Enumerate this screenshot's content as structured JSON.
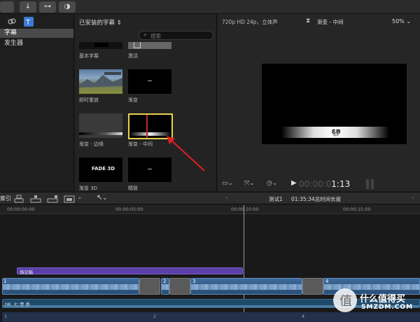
{
  "toolbar": {
    "download_icon": "↓",
    "key_icon": "⊶",
    "half_icon": "◑"
  },
  "sidebar": {
    "items": [
      {
        "label": "字幕",
        "selected": true
      },
      {
        "label": "发生器",
        "selected": false
      }
    ]
  },
  "browser": {
    "category": "已安装的字幕",
    "search_placeholder": "搜索",
    "thumbs": [
      {
        "label": "基本字幕"
      },
      {
        "label": "激活"
      },
      {
        "label": "即时重放"
      },
      {
        "label": "渐变"
      },
      {
        "label": "渐变 - 边缘"
      },
      {
        "label": "渐变 - 中间",
        "selected": true
      },
      {
        "label": "渐变 3D",
        "inner_text": "FADE 3D"
      },
      {
        "label": "精致"
      }
    ]
  },
  "viewer": {
    "format": "720p HD 24p，立体声",
    "clip_title": "渐变 - 中间",
    "zoom": "50%",
    "lower_third_title": "名称",
    "lower_third_subtitle": "描述",
    "timecode_dim": "00:00:0",
    "timecode_bright": "1:13"
  },
  "timeline_header": {
    "index_label": "索引",
    "project_name": "测试1",
    "duration": "01:35:34总时间长度"
  },
  "ruler": {
    "ticks": [
      "00:00:00:00",
      "00:00:05:00",
      "00:00:10:00",
      "00:00:15:00"
    ]
  },
  "tracks": {
    "title_clip": "场记板",
    "clip_numbers": [
      "1",
      "2",
      "3",
      "4"
    ],
    "audio_clip": "08. 七 里 香",
    "audio_numbers": [
      "1",
      "2",
      "4"
    ]
  },
  "watermark": {
    "brand": "什么值得买",
    "site": "SMZDM.COM"
  }
}
